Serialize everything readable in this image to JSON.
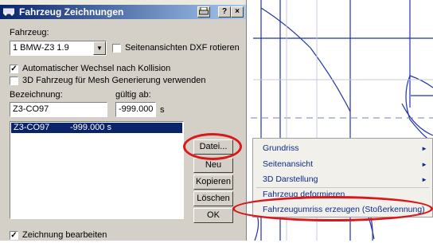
{
  "window": {
    "title": "Fahrzeug Zeichnungen",
    "help_label": "?",
    "close_label": "×"
  },
  "vehicle": {
    "label": "Fahrzeug:",
    "value": "1 BMW-Z3 1.9"
  },
  "options": {
    "rotate_dxf": {
      "label": "Seitenansichten DXF rotieren",
      "checked": false
    },
    "auto_switch": {
      "label": "Automatischer Wechsel nach Kollision",
      "checked": true
    },
    "mesh_gen": {
      "label": "3D Fahrzeug für Mesh Generierung verwenden",
      "checked": false
    }
  },
  "name_field": {
    "label": "Bezeichnung:",
    "value": "Z3-CO97"
  },
  "valid_field": {
    "label": "gültig ab:",
    "value": "-999.000",
    "unit": "s"
  },
  "drawings": [
    {
      "name": "Z3-CO97",
      "time": "-999.000 s"
    }
  ],
  "buttons": {
    "datei": "Datei...",
    "neu": "Neu",
    "kopieren": "Kopieren",
    "loeschen": "Löschen",
    "ok": "OK"
  },
  "edit_drawing": {
    "label": "Zeichnung bearbeiten",
    "checked": true
  },
  "context_menu": {
    "items": [
      "Grundriss",
      "Seitenansicht",
      "3D Darstellung",
      "Fahrzeug deformieren",
      "Fahrzeugumriss erzeugen (Stoßerkennung)"
    ],
    "submenu_arrow": "►"
  },
  "colors": {
    "highlight_ellipse": "#d8181a",
    "title_bar": "#0a246a",
    "menu_text": "#0b2a8c",
    "list_selection": "#0a246a"
  }
}
